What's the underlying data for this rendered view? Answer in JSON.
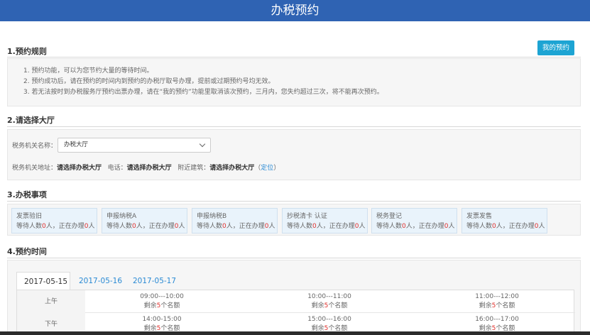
{
  "header": {
    "title": "办税预约"
  },
  "sections": {
    "rules_title": "1.预约规则",
    "hall_title": "2.请选择大厅",
    "items_title": "3.办税事项",
    "time_title": "4.预约时间"
  },
  "my_booking_label": "我的预约",
  "rules": [
    "1. 预约功能，可以为您节约大量的等待时间。",
    "2. 预约成功后，请在预约的时间内到预约的办税厅取号办理，提前或过期预约号均无效。",
    "3. 若无法按时到办税服务厅预约出票办理，请在“我的预约”功能里取消该次预约，三月内，您失约超过三次，将不能再次预约。"
  ],
  "hall": {
    "label": "税务机关名称：",
    "selected": "办税大厅",
    "addr_label": "税务机关地址：",
    "addr_value": "请选择办税大厅",
    "phone_label": "电话：",
    "phone_value": "请选择办税大厅",
    "near_label": "附近建筑：",
    "near_value": "请选择办税大厅",
    "locate_open": "（",
    "locate_link": "定位",
    "locate_close": "）"
  },
  "items": [
    {
      "name": "发票验旧",
      "waiting": "0",
      "serving": "0"
    },
    {
      "name": "申报纳税A",
      "waiting": "0",
      "serving": "0"
    },
    {
      "name": "申报纳税B",
      "waiting": "0",
      "serving": "0"
    },
    {
      "name": "抄税清卡 认证",
      "waiting": "0",
      "serving": "0"
    },
    {
      "name": "税务登记",
      "waiting": "0",
      "serving": "0"
    },
    {
      "name": "发票发售",
      "waiting": "0",
      "serving": "0"
    }
  ],
  "count_text": {
    "a": "等待人数",
    "b": "人，正在办理",
    "c": "人"
  },
  "dates": [
    "2017-05-15",
    "2017-05-16",
    "2017-05-17"
  ],
  "schedule": {
    "morning_label": "上午",
    "afternoon_label": "下午",
    "remain_prefix": "剩余",
    "remain_suffix": "个名额",
    "morning": [
      {
        "time": "09:00---10:00",
        "remain": "5"
      },
      {
        "time": "10:00---11:00",
        "remain": "5"
      },
      {
        "time": "11:00---12:00",
        "remain": "5"
      }
    ],
    "afternoon": [
      {
        "time": "14:00-15:00",
        "remain": "5"
      },
      {
        "time": "15:00---16:00",
        "remain": "5"
      },
      {
        "time": "16:00---17:00",
        "remain": "5"
      }
    ]
  }
}
